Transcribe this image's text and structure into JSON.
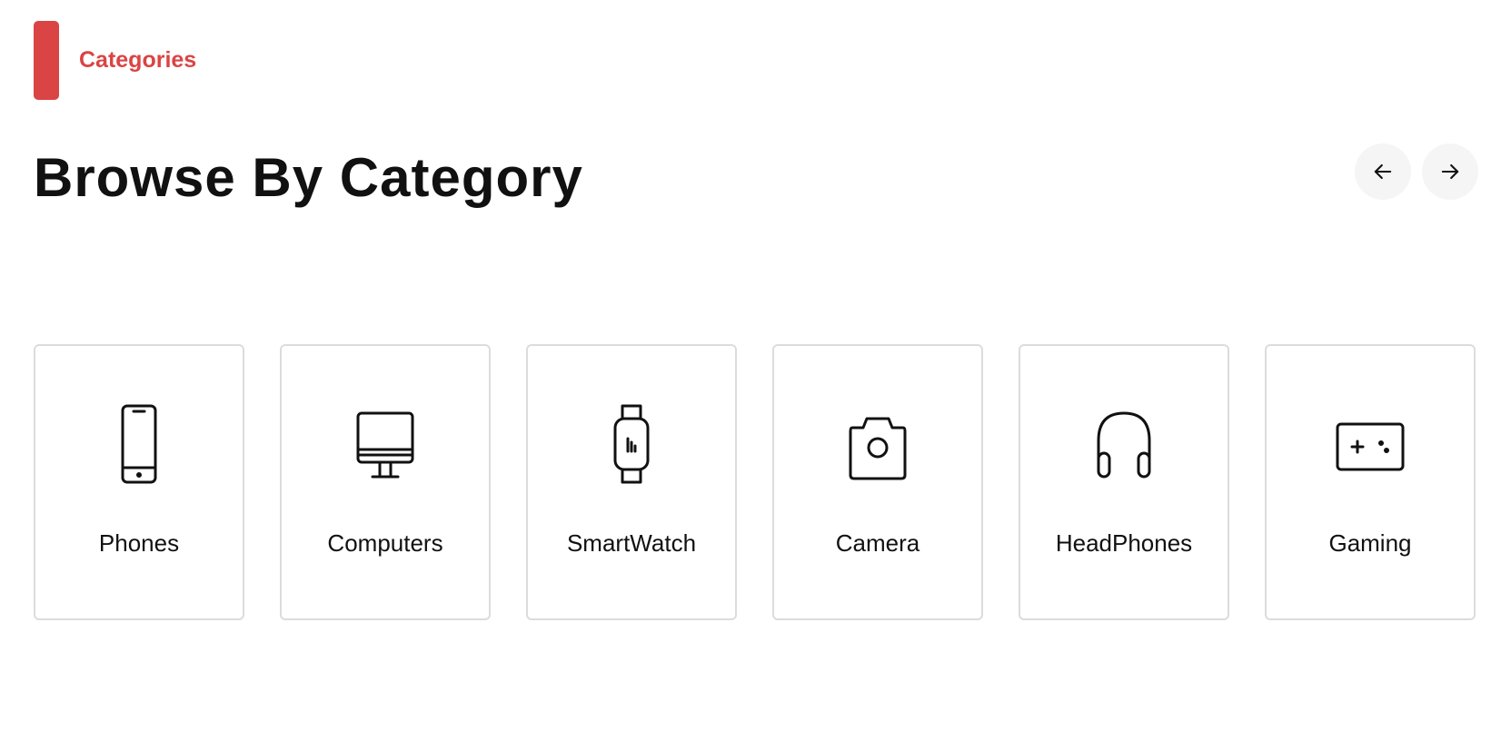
{
  "section": {
    "tag_label": "Categories",
    "title": "Browse By Category"
  },
  "navigation": {
    "prev_icon": "arrow-left-icon",
    "next_icon": "arrow-right-icon"
  },
  "categories": [
    {
      "label": "Phones",
      "icon": "phone-icon"
    },
    {
      "label": "Computers",
      "icon": "computer-icon"
    },
    {
      "label": "SmartWatch",
      "icon": "smartwatch-icon"
    },
    {
      "label": "Camera",
      "icon": "camera-icon"
    },
    {
      "label": "HeadPhones",
      "icon": "headphones-icon"
    },
    {
      "label": "Gaming",
      "icon": "gamepad-icon"
    }
  ],
  "colors": {
    "accent": "#db4444",
    "card_border": "#dcdcdc",
    "arrow_background": "#f5f5f5"
  }
}
